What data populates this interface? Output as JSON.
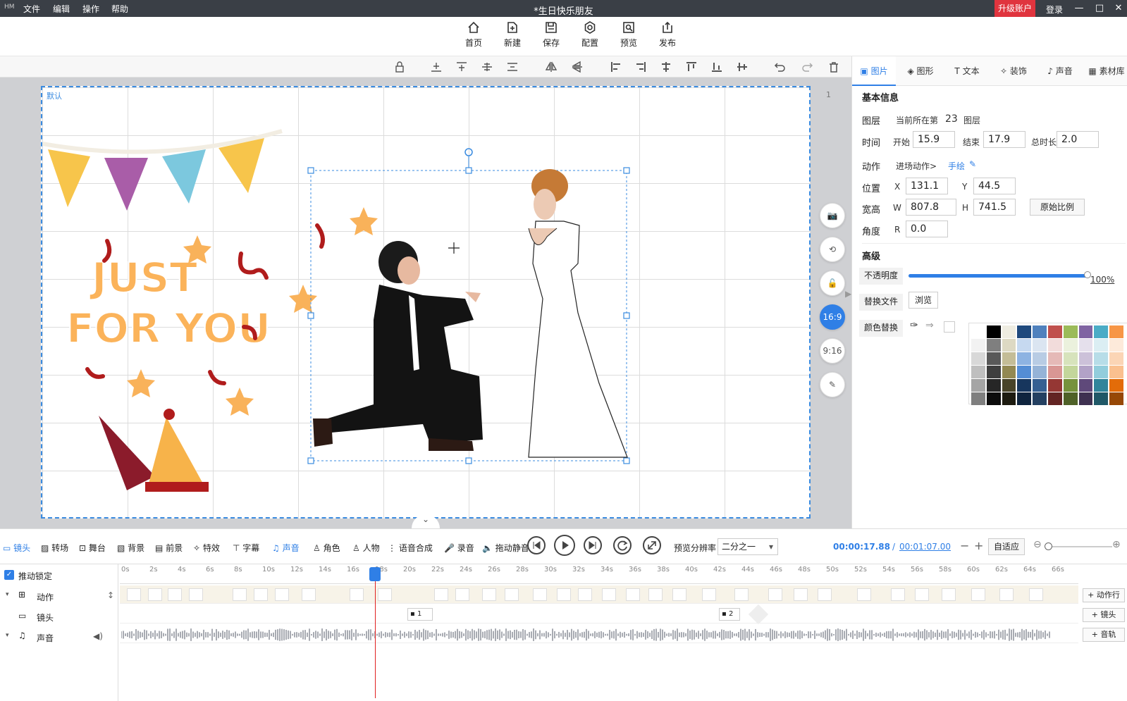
{
  "titlebar": {
    "logo": "HM",
    "menus": [
      "文件",
      "编辑",
      "操作",
      "帮助"
    ],
    "title": "*生日快乐朋友",
    "upgrade": "升级账户",
    "login": "登录"
  },
  "toolbar": {
    "home": "首页",
    "new": "新建",
    "save": "保存",
    "config": "配置",
    "preview": "预览",
    "publish": "发布"
  },
  "canvas": {
    "label": "默认",
    "text1": "JUST",
    "text2": "FOR YOU",
    "page_number": "1"
  },
  "side_tools": {
    "ratio_169": "16:9",
    "ratio_916": "9:16"
  },
  "rpanel": {
    "tabs": [
      "图片",
      "图形",
      "文本",
      "装饰",
      "声音",
      "素材库"
    ],
    "basic_info": "基本信息",
    "layer_label": "图层",
    "layer_text": "当前所在第",
    "layer_num": "23",
    "layer_unit": "图层",
    "time_label": "时间",
    "start_label": "开始",
    "start": "15.9",
    "end_label": "结束",
    "end": "17.9",
    "dur_label": "总时长",
    "duration": "2.0",
    "action_label": "动作",
    "action_enter": "进场动作>",
    "action_hand": "手绘",
    "pos_label": "位置",
    "x_label": "X",
    "x": "131.1",
    "y_label": "Y",
    "y": "44.5",
    "size_label": "宽高",
    "w_label": "W",
    "w": "807.8",
    "h_label": "H",
    "h": "741.5",
    "orig_ratio": "原始比例",
    "angle_label": "角度",
    "r_label": "R",
    "r": "0.0",
    "advanced": "高级",
    "opacity_label": "不透明度",
    "opacity_value": "100%",
    "opacity": 1.0,
    "replace_label": "替换文件",
    "browse": "浏览",
    "color_replace": "颜色替换"
  },
  "swatch_colors": [
    [
      "#ffffff",
      "#000000",
      "#eeece1",
      "#1f497d",
      "#4f81bd",
      "#c0504d",
      "#9bbb59",
      "#8064a2",
      "#4bacc6",
      "#f79646"
    ],
    [
      "#f2f2f2",
      "#7f7f7f",
      "#ddd9c3",
      "#c6d9f0",
      "#dbe5f1",
      "#f2dcdb",
      "#ebf1dd",
      "#e5e0ec",
      "#dbeef3",
      "#fdeada"
    ],
    [
      "#d8d8d8",
      "#595959",
      "#c4bd97",
      "#8db3e2",
      "#b8cce4",
      "#e5b9b7",
      "#d7e3bc",
      "#ccc1d9",
      "#b7dde8",
      "#fbd5b5"
    ],
    [
      "#bfbfbf",
      "#3f3f3f",
      "#938953",
      "#548dd4",
      "#95b3d7",
      "#d99694",
      "#c3d69b",
      "#b2a2c7",
      "#92cddc",
      "#fac08f"
    ],
    [
      "#a5a5a5",
      "#262626",
      "#494429",
      "#17365d",
      "#366092",
      "#953734",
      "#76923c",
      "#5f497a",
      "#31859b",
      "#e36c09"
    ],
    [
      "#7f7f7f",
      "#0c0c0c",
      "#1d1b10",
      "#0f243e",
      "#244061",
      "#632423",
      "#4f6128",
      "#3f3151",
      "#205867",
      "#974806"
    ]
  ],
  "controls": {
    "items": [
      "镜头",
      "转场",
      "舞台",
      "背景",
      "前景",
      "特效",
      "字幕",
      "声音",
      "角色",
      "人物",
      "语音合成",
      "录音",
      "拖动静音"
    ],
    "res_label": "预览分辨率",
    "res_value": "二分之一",
    "time_current": "00:00:17.88",
    "time_sep": "/",
    "time_total": "00:01:07.00",
    "fit": "自适应"
  },
  "timeline": {
    "lock": "推动锁定",
    "track_action": "动作",
    "track_camera": "镜头",
    "track_sound": "声音",
    "add_action": "+ 动作行",
    "add_camera": "+ 镜头",
    "add_sound": "+ 音轨",
    "ticks": [
      "0s",
      "2s",
      "4s",
      "6s",
      "8s",
      "10s",
      "12s",
      "14s",
      "16s",
      "18s",
      "20s",
      "22s",
      "24s",
      "26s",
      "28s",
      "30s",
      "32s",
      "34s",
      "36s",
      "38s",
      "40s",
      "42s",
      "44s",
      "46s",
      "48s",
      "50s",
      "52s",
      "54s",
      "56s",
      "58s",
      "60s",
      "62s",
      "64s",
      "66s"
    ],
    "cam1": "1",
    "cam2": "2"
  }
}
